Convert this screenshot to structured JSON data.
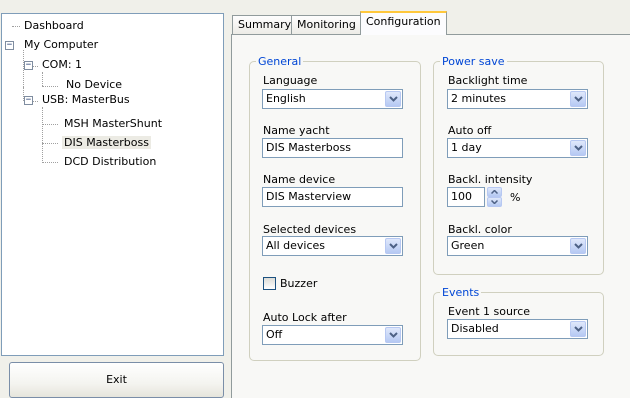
{
  "tree": {
    "dashboard": "Dashboard",
    "my_computer": "My Computer",
    "com": "COM: 1",
    "no_device": "No Device",
    "usb": "USB: MasterBus",
    "msh": "MSH MasterShunt",
    "dis": "DIS Masterboss",
    "dcd": "DCD Distribution"
  },
  "exit_label": "Exit",
  "tabs": [
    "Summary",
    "Monitoring",
    "Configuration"
  ],
  "general": {
    "title": "General",
    "language_label": "Language",
    "language_value": "English",
    "name_yacht_label": "Name yacht",
    "name_yacht_value": "DIS Masterboss",
    "name_device_label": "Name device",
    "name_device_value": "DIS Masterview",
    "selected_devices_label": "Selected devices",
    "selected_devices_value": "All devices",
    "buzzer_label": "Buzzer",
    "buzzer_checked": false,
    "auto_lock_label": "Auto Lock after",
    "auto_lock_value": "Off"
  },
  "power_save": {
    "title": "Power save",
    "backlight_time_label": "Backlight time",
    "backlight_time_value": "2 minutes",
    "auto_off_label": "Auto off",
    "auto_off_value": "1 day",
    "intensity_label": "Backl. intensity",
    "intensity_value": "100",
    "intensity_unit": "%",
    "color_label": "Backl. color",
    "color_value": "Green"
  },
  "events": {
    "title": "Events",
    "event1_label": "Event 1 source",
    "event1_value": "Disabled"
  },
  "colors": {
    "group_title": "#0046d5",
    "active_tab_accent": "#ffc83c",
    "field_border": "#7f9db9"
  }
}
